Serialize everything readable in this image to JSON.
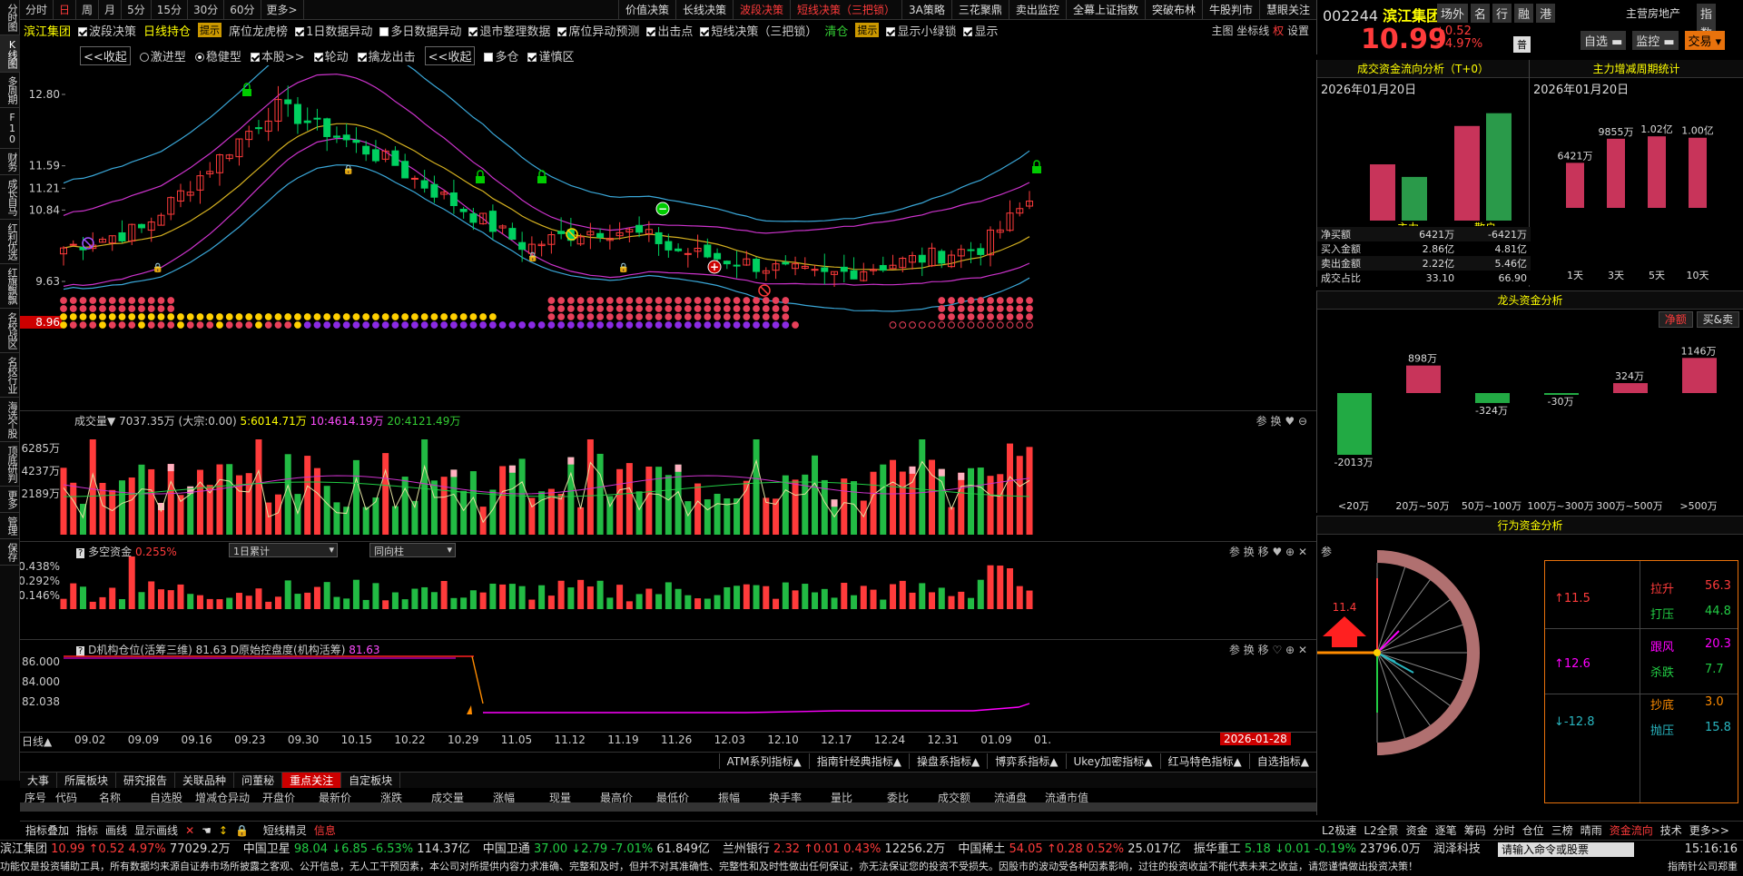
{
  "left_tabs": [
    "分时图",
    "K线图",
    "多周期",
    "F10",
    "财务",
    "成长自马",
    "红利优选",
    "红旗飘飘",
    "名校战区",
    "名校行业",
    "海选个股",
    "顶底研判",
    "更多",
    "管理",
    "保存"
  ],
  "period_tabs": [
    "分时",
    "日",
    "周",
    "月",
    "5分",
    "15分",
    "30分",
    "60分",
    "更多>"
  ],
  "top_right_tabs": [
    "价值决策",
    "长线决策",
    "波段决策",
    "短线决策（三把锁）",
    "3A策略",
    "三花聚鼎",
    "卖出监控",
    "全幕上证指数",
    "突破布林",
    "牛股判市",
    "慧眼关注"
  ],
  "row2": {
    "stock": "滨江集团",
    "items": [
      "波段决策",
      "日线持仓",
      "提示",
      "席位龙虎榜",
      "1日数据异动",
      "多日数据异动",
      "退市整理数据",
      "席位异动预测",
      "出击点",
      "短线决策（三把锁）",
      "清仓",
      "提示",
      "显示小绿锁",
      "显示"
    ],
    "right": [
      "主图",
      "坐标线",
      "权",
      "设置"
    ]
  },
  "row3": [
    "<<收起",
    "激进型",
    "稳健型",
    "本股>>",
    "轮动",
    "擒龙出击",
    "<<收起",
    "多仓",
    "谨慎区"
  ],
  "main_chart": {
    "y_ticks": [
      "12.80",
      "11.59",
      "11.21",
      "10.84",
      "9.63"
    ],
    "current_price_label": "8.96"
  },
  "volume_panel": {
    "title": "成交量▼",
    "value": "7037.35万",
    "dazong": "(大宗:0.00)",
    "ma5": "5:6014.71万",
    "ma10": "10:4614.19万",
    "ma20": "20:4121.49万",
    "y_ticks": [
      "6285万",
      "4237万",
      "2189万"
    ],
    "controls": [
      "参",
      "换"
    ]
  },
  "dk_panel": {
    "title": "多空资金",
    "value": "0.255%",
    "select1": "1日累计",
    "select2": "同向柱",
    "y_ticks": [
      "0.438%",
      "0.292%",
      "0.146%"
    ],
    "controls": [
      "参",
      "换",
      "移"
    ]
  },
  "jg_panel": {
    "title": "D机构仓位(活筹三维)",
    "value": "81.63",
    "title2": "D原始控盘度(机构活筹)",
    "value2": "81.63",
    "y_ticks": [
      "86.000",
      "84.000",
      "82.038"
    ],
    "controls": [
      "参",
      "换",
      "移"
    ]
  },
  "x_axis": {
    "label": "日线▲",
    "dates": [
      "09.02",
      "09.09",
      "09.16",
      "09.23",
      "09.30",
      "10.15",
      "10.22",
      "10.29",
      "11.05",
      "11.12",
      "11.19",
      "11.26",
      "12.03",
      "12.10",
      "12.17",
      "12.24",
      "12.31",
      "01.09",
      "01."
    ],
    "current_date": "2026-01-28"
  },
  "indicator_bar": [
    "ATM系列指标▲",
    "指南针经典指标▲",
    "操盘系指标▲",
    "博弈系指标▲",
    "Ukey加密指标▲",
    "红马特色指标▲",
    "自选指标▲"
  ],
  "bottom_tabs": [
    "大事",
    "所属板块",
    "研究报告",
    "关联品种",
    "问董秘",
    "重点关注",
    "自定板块"
  ],
  "table_headers": [
    "序号",
    "代码",
    "名称",
    "自选股",
    "增减仓异动",
    "开盘价",
    "最新价",
    "涨跌",
    "成交量",
    "涨幅",
    "现量",
    "最高价",
    "最低价",
    "振幅",
    "换手率",
    "量比",
    "委比",
    "成交额",
    "流通盘",
    "流通市值"
  ],
  "toolbar": [
    "指标叠加",
    "指标",
    "画线",
    "显示画线",
    "短线精灵",
    "信息"
  ],
  "header": {
    "code": "002244",
    "name": "滨江集团",
    "tags": [
      "场外",
      "名",
      "行",
      "融",
      "港"
    ],
    "industry": "主营房地产",
    "right_btns": [
      "指",
      "数"
    ],
    "price": "10.99",
    "change": "+0.52",
    "pct": "+4.97%",
    "pu": "普",
    "btns": [
      "自选",
      "监控",
      "交易"
    ]
  },
  "flow_section": {
    "title": "成交资金流向分析（T+0）",
    "date": "2026年01月20日",
    "legend": [
      "主力",
      "散户"
    ],
    "rows": [
      {
        "label": "净买额",
        "a": "6421万",
        "b": "-6421万"
      },
      {
        "label": "买入金额",
        "a": "2.86亿",
        "b": "4.81亿"
      },
      {
        "label": "卖出金额",
        "a": "2.22亿",
        "b": "5.46亿"
      },
      {
        "label": "成交占比",
        "a": "33.10",
        "b": "66.90"
      }
    ],
    "bars": [
      {
        "name": "主力买",
        "value": 2.86,
        "color": "#c8345a"
      },
      {
        "name": "主力卖",
        "value": 2.22,
        "color": "#2a9a4a"
      },
      {
        "name": "散户买",
        "value": 4.81,
        "color": "#c8345a"
      },
      {
        "name": "散户卖",
        "value": 5.46,
        "color": "#2a9a4a"
      }
    ]
  },
  "cycle_section": {
    "title": "主力增减周期统计",
    "date": "2026年01月20日",
    "labels": [
      "1天",
      "3天",
      "5天",
      "10天"
    ],
    "values": [
      "6421万",
      "9855万",
      "1.02亿",
      "1.00亿"
    ],
    "nums": [
      0.6421,
      0.9855,
      1.02,
      1.0
    ]
  },
  "dragon_section": {
    "title": "龙头资金分析",
    "tabs": [
      "净额",
      "买&卖"
    ],
    "cats": [
      "<20万",
      "20万~50万",
      "50万~100万",
      "100万~300万",
      "300万~500万",
      ">500万"
    ],
    "values": [
      "-2013万",
      "898万",
      "-324万",
      "-30万",
      "324万",
      "1146万"
    ],
    "nums": [
      -2013,
      898,
      -324,
      -30,
      324,
      1146
    ]
  },
  "behavior_section": {
    "title": "行为资金分析",
    "param": "参",
    "arrow_value": "11.4",
    "legend_left": [
      "↑11.5",
      "↑12.6",
      "↓-12.8"
    ],
    "legend": [
      {
        "k": "拉升",
        "v": "56.3"
      },
      {
        "k": "打压",
        "v": "44.8"
      },
      {
        "k": "跟风",
        "v": "20.3"
      },
      {
        "k": "杀跌",
        "v": "7.7"
      },
      {
        "k": "抄底",
        "v": "3.0"
      },
      {
        "k": "抛压",
        "v": "15.8"
      }
    ]
  },
  "right_bottom_tabs": [
    "L2极速",
    "L2全景",
    "资金",
    "逐笔",
    "筹码",
    "分时",
    "仓位",
    "三榜",
    "晴雨",
    "资金流向",
    "技术",
    "更多>>"
  ],
  "ticker": [
    {
      "name": "滨江集团",
      "price": "10.99",
      "chg": "↑0.52",
      "pct": "4.97%",
      "vol": "77029.2万",
      "dir": "up"
    },
    {
      "name": "中国卫星",
      "price": "98.04",
      "chg": "↓6.85",
      "pct": "-6.53%",
      "vol": "114.37亿",
      "dir": "down"
    },
    {
      "name": "中国卫通",
      "price": "37.00",
      "chg": "↓2.79",
      "pct": "-7.01%",
      "vol": "61.849亿",
      "dir": "down"
    },
    {
      "name": "兰州银行",
      "price": "2.32",
      "chg": "↑0.01",
      "pct": "0.43%",
      "vol": "12256.2万",
      "dir": "up"
    },
    {
      "name": "中国稀土",
      "price": "54.05",
      "chg": "↑0.28",
      "pct": "0.52%",
      "vol": "25.017亿",
      "dir": "up"
    },
    {
      "name": "振华重工",
      "price": "5.18",
      "chg": "↓0.01",
      "pct": "-0.19%",
      "vol": "23796.0万",
      "dir": "down"
    },
    {
      "name": "润泽科技",
      "price": "",
      "chg": "",
      "pct": "",
      "vol": "",
      "dir": "up"
    }
  ],
  "command_placeholder": "请输入命令或股票",
  "clock": "15:16:16",
  "disclaimer": "功能仅是投资辅助工具，所有数据均来源自证券市场所披露之客观、公开信息，无人工干预因素，本公司对所提供内容力求准确、完整和及时，但并不对其准确性、完整性和及时性做出任何保证，亦无法保证您的投资不受损失。因股市的波动受各种因素影响，过往的投资收益不能代表未来之收益，请您谨慎做出投资决策！",
  "brand": "指南针公司郑重"
}
